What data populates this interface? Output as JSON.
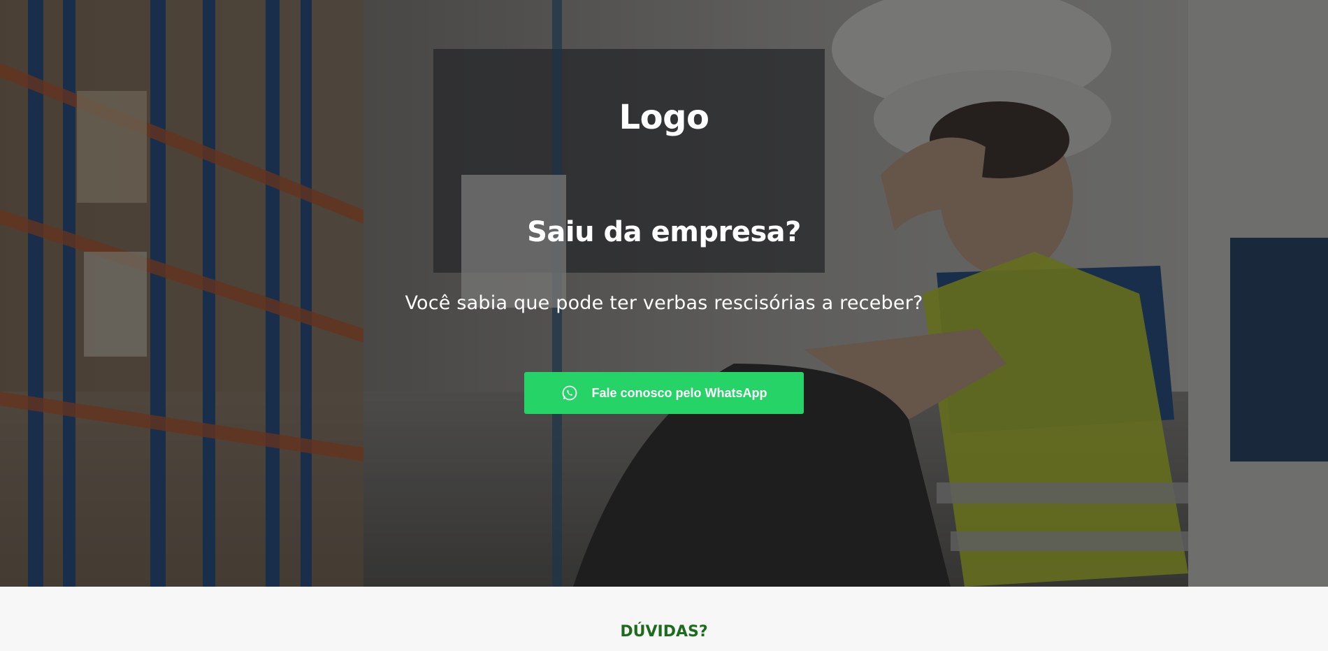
{
  "hero": {
    "logo": "Logo",
    "headline": "Saiu da empresa?",
    "subtitle": "Você sabia que pode ter verbas rescisórias a receber?",
    "cta": {
      "label": "Fale conosco pelo WhatsApp",
      "icon": "whatsapp-icon",
      "color": "#25d366"
    },
    "background_image": "worried-warehouse-worker-photo"
  },
  "faq": {
    "title": "DÚVIDAS?",
    "title_color": "#1d6b1d"
  }
}
